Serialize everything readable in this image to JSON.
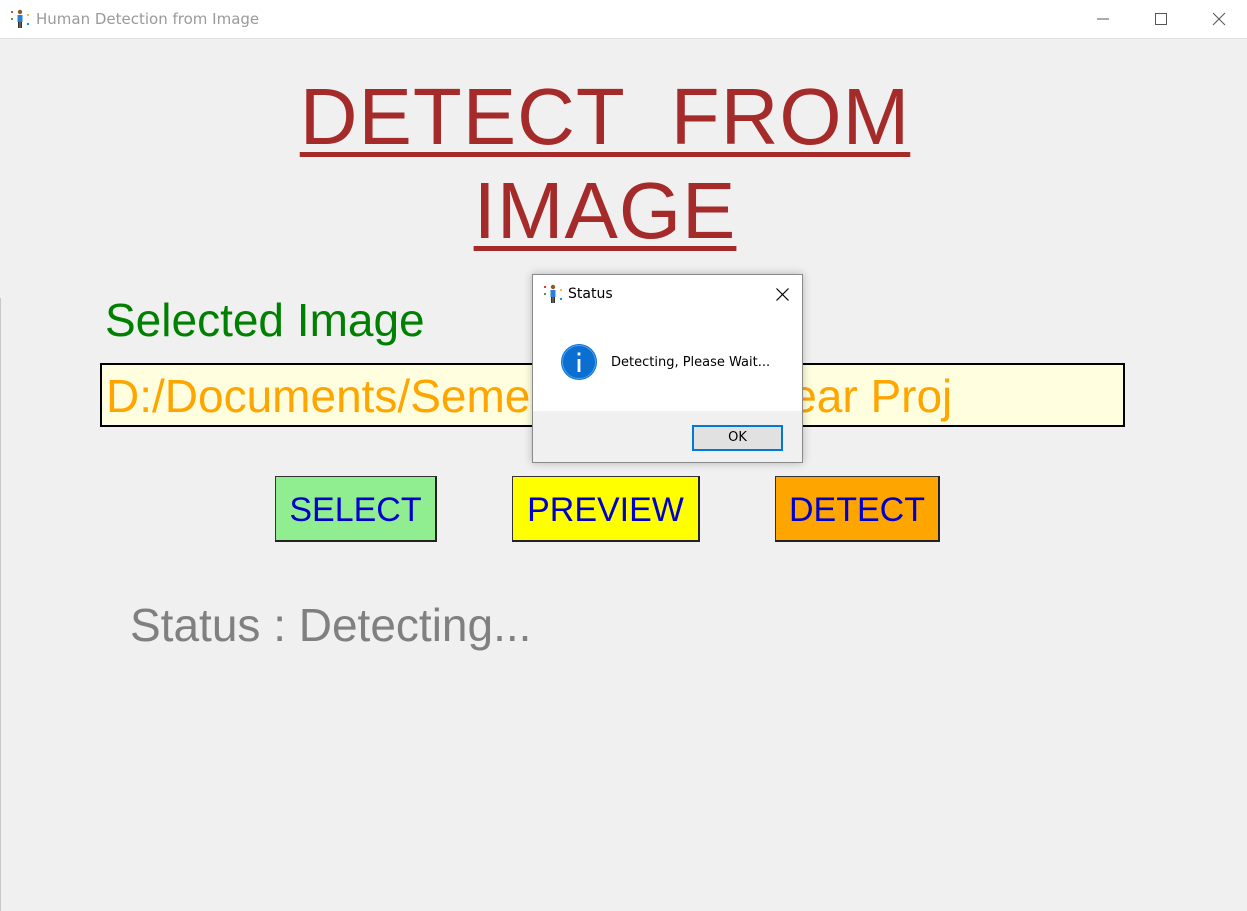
{
  "window": {
    "title": "Human Detection from Image",
    "icon": "person-icon"
  },
  "heading": {
    "line1": "DETECT  FROM",
    "line2": "IMAGE",
    "color": "#a52a2a"
  },
  "selected_label": "Selected Image",
  "path_value": "D:/Documents/Semester 6 - 3rd Year Proj",
  "buttons": {
    "select": "SELECT",
    "preview": "PREVIEW",
    "detect": "DETECT"
  },
  "button_colors": {
    "select": "#90ee90",
    "preview": "#ffff00",
    "detect": "#ffa500",
    "text": "#0000cd"
  },
  "status_text": "Status : Detecting...",
  "dialog": {
    "title": "Status",
    "message": "Detecting, Please Wait...",
    "ok_label": "OK",
    "icon": "info-icon"
  }
}
